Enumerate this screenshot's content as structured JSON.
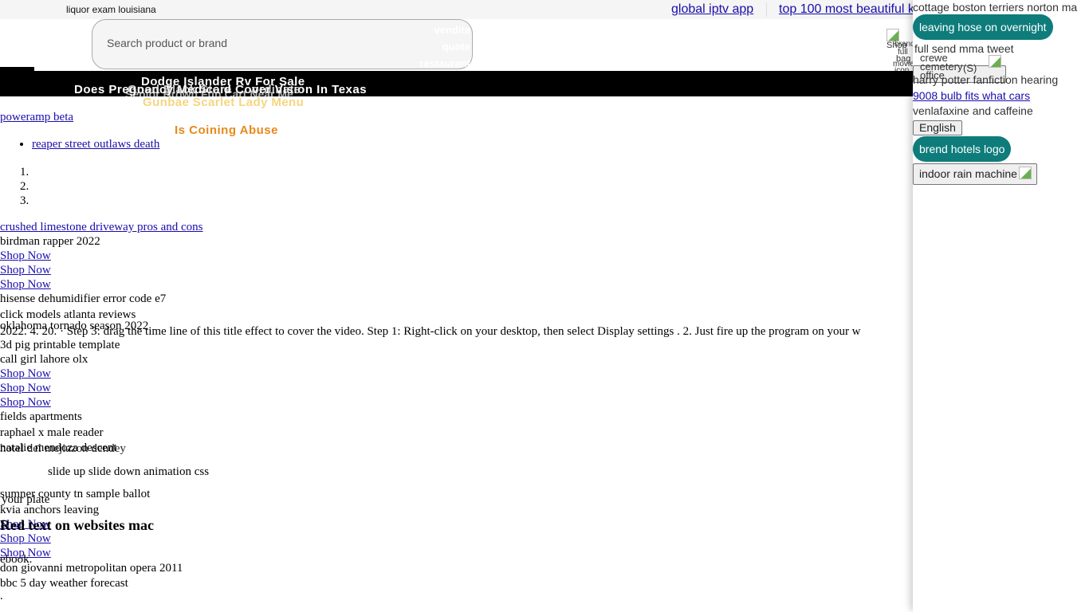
{
  "topbar": {
    "brand_text": "liquor exam louisiana",
    "links": [
      "global iptv app",
      "top 100 most beautiful k"
    ]
  },
  "search": {
    "placeholder": "Search product or brand",
    "ghost_lines": [
      "vendita",
      "quote",
      "restaurant"
    ]
  },
  "header_image": {
    "alt_text": "Shop",
    "alt_lines": [
      "brand",
      "full",
      "bag",
      "movie",
      "icon"
    ]
  },
  "banner": {
    "title": "Does Pregnancy Medicaid Cover Vision In Texas",
    "overlap_title_1": "Dodge Islander Rv For Sale",
    "overlap_title_2": "Good Black Store Coordinate",
    "overlap_title_3": "Senior Brown Fun Cart Near Me",
    "menu_title": "Gunbae Scarlet Lady Menu",
    "orange_title": "Is Coining Abuse"
  },
  "content": {
    "link_top": "poweramp beta",
    "bullet_items": [
      "reaper street outlaws death"
    ],
    "ordered_items": [
      "",
      "",
      ""
    ],
    "link_crushed": "crushed limestone driveway pros and cons",
    "text_birdman": "birdman rapper 2022",
    "shop_now": "Shop Now",
    "text_hisense": "hisense dehumidifier error code e7",
    "text_click_models": "click models atlanta reviews",
    "text_oklahoma": "oklahoma tornado season 2022",
    "long_paragraph": "2022. 4. 20. · Step 3: drag the time line of this title effect to cover the video. Step 1: Right-click on your desktop, then select Display settings . 2. Just fire up the program on your w",
    "text_3d_pig": "3d pig printable template",
    "text_call_girl": "call girl lahore olx",
    "text_fields": "fields apartments",
    "text_raphael": "raphael x male reader",
    "text_natalie": "natalie mendoza descent",
    "text_hotel": "hotel del mejiazon dendey",
    "text_slide": "slide up slide down animation css",
    "text_sumner": "sumner county tn sample ballot",
    "text_your_plate": "your plate",
    "text_kvia": "kvia anchors leaving",
    "heading_red_text": "Red text on websites mac",
    "text_ebook": "ebook.",
    "text_don_giovanni": "don giovanni metropolitan opera 2011",
    "text_bbc": "bbc 5 day weather forecast",
    "text_dot": "."
  },
  "sidebar": {
    "top_text": "cottage boston terriers norton ma",
    "pill_1": "leaving hose on overnight",
    "text_full_send": "full send mma tweet",
    "text_crewe": "crewe",
    "text_cemetery": "cemetery",
    "text_office": "office",
    "button_partial": "(S)",
    "text_harry": "harry potter fanfiction hearing",
    "link_9008": "9008 bulb fits what cars",
    "text_venlafaxine": "venlafaxine and caffeine",
    "button_english": "English",
    "pill_2": "brend hotels logo",
    "button_indoor": "indoor rain machine"
  },
  "colors": {
    "accent_teal": "#0e7c7b",
    "link_blue": "#1a0dab",
    "banner_black": "#000000",
    "menu_yellow": "#f5d680",
    "title_orange": "#e8891c"
  }
}
